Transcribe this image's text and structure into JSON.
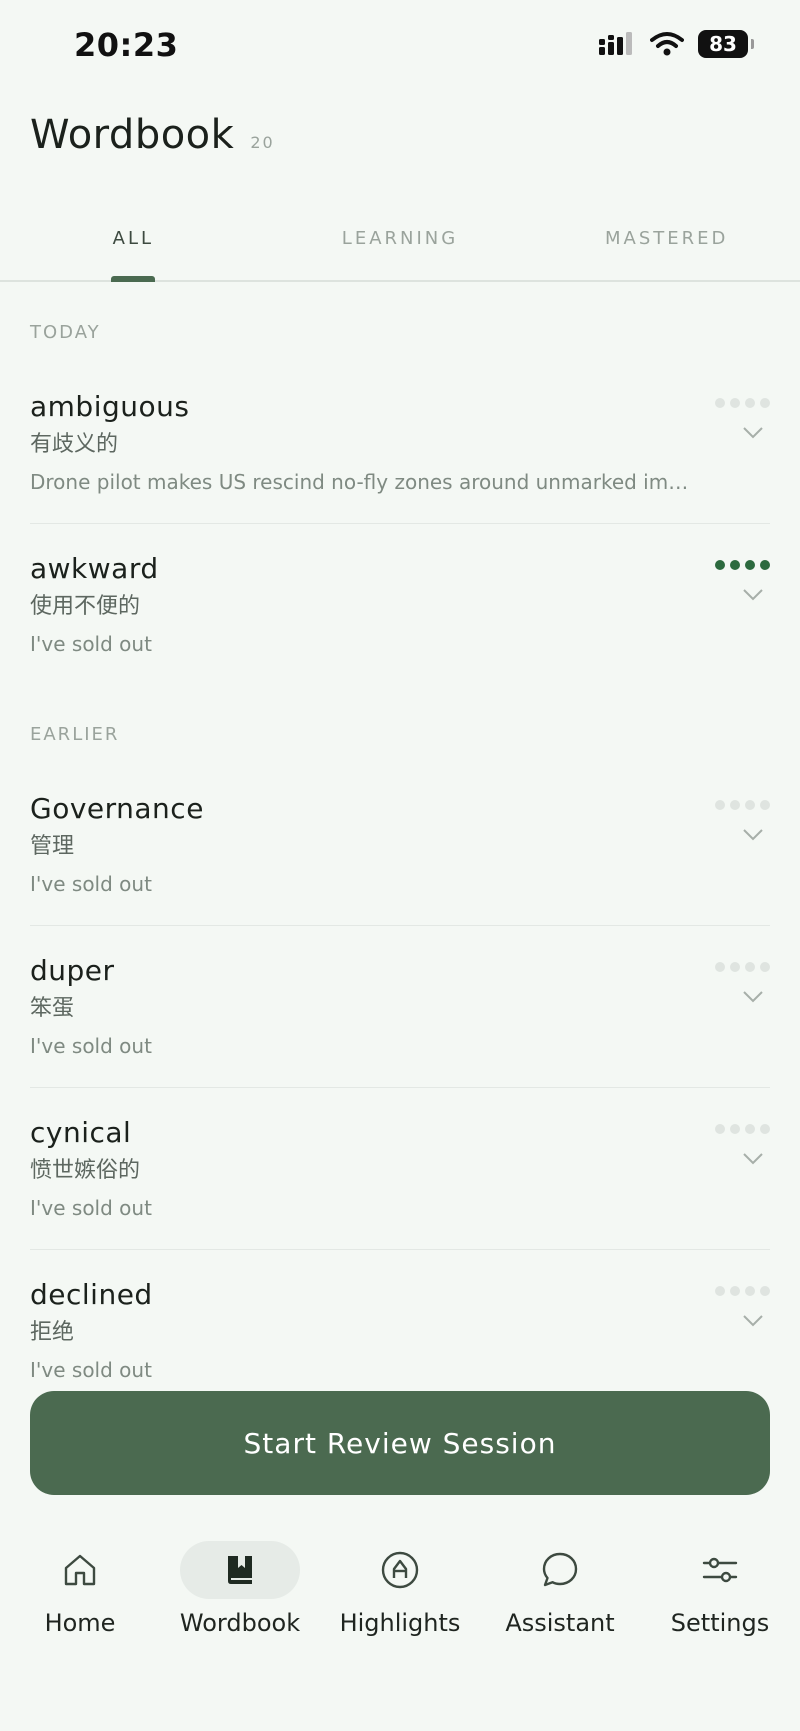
{
  "status": {
    "time": "20:23",
    "battery": "83"
  },
  "header": {
    "title": "Wordbook",
    "count": "20"
  },
  "tabs": [
    {
      "label": "ALL",
      "active": true
    },
    {
      "label": "LEARNING",
      "active": false
    },
    {
      "label": "MASTERED",
      "active": false
    }
  ],
  "sections": [
    {
      "label": "TODAY",
      "entries": [
        {
          "word": "ambiguous",
          "translation": "有歧义的",
          "example": "Drone pilot makes US rescind no-fly zones around unmarked immigration vehicles",
          "progress": 0
        },
        {
          "word": "awkward",
          "translation": "使用不便的",
          "example": "I've sold out",
          "progress": 4
        }
      ]
    },
    {
      "label": "EARLIER",
      "entries": [
        {
          "word": "Governance",
          "translation": "管理",
          "example": "I've sold out",
          "progress": 0
        },
        {
          "word": "duper",
          "translation": "笨蛋",
          "example": "I've sold out",
          "progress": 0
        },
        {
          "word": "cynical",
          "translation": "愤世嫉俗的",
          "example": "I've sold out",
          "progress": 0
        },
        {
          "word": "declined",
          "translation": "拒绝",
          "example": "I've sold out",
          "progress": 0
        }
      ]
    }
  ],
  "review_button": {
    "label": "Start Review Session"
  },
  "nav": [
    {
      "label": "Home",
      "icon": "home-icon",
      "active": false
    },
    {
      "label": "Wordbook",
      "icon": "book-icon",
      "active": true
    },
    {
      "label": "Highlights",
      "icon": "highlighter-icon",
      "active": false
    },
    {
      "label": "Assistant",
      "icon": "chat-bubble-icon",
      "active": false
    },
    {
      "label": "Settings",
      "icon": "sliders-icon",
      "active": false
    }
  ],
  "colors": {
    "accent": "#4b6a50",
    "background": "#f4f8f4",
    "progress_full": "#2c6a3e"
  }
}
